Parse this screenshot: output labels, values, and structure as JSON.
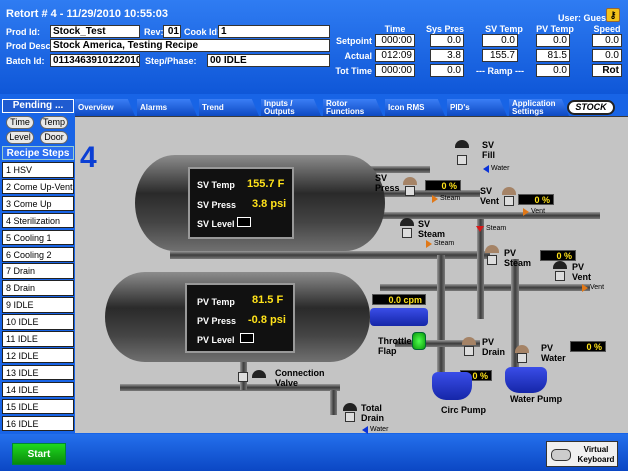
{
  "header": {
    "title": "Retort # 4 - 11/29/2010 10:55:03",
    "prod_id_label": "Prod Id:",
    "prod_id": "Stock_Test",
    "rev_label": "Rev:",
    "rev": "01",
    "cook_id_label": "Cook Id:",
    "cook_id": "1",
    "prod_desc_label": "Prod Desc:",
    "prod_desc": "Stock America, Testing Recipe",
    "batch_id_label": "Batch Id:",
    "batch_id": "0113463910122010",
    "step_phase_label": "Step/Phase:",
    "step_phase": "00 IDLE",
    "user_label": "User: Guest"
  },
  "readouts": {
    "columns": [
      "Time",
      "Sys Pres",
      "SV Temp",
      "PV Temp",
      "Speed"
    ],
    "rows": [
      {
        "label": "Setpoint",
        "values": [
          "000:00",
          "0.0",
          "0.0",
          "0.0",
          "0.0"
        ]
      },
      {
        "label": "Actual",
        "values": [
          "012:09",
          "3.8",
          "155.7",
          "81.5",
          "0.0"
        ]
      },
      {
        "label": "Tot Time",
        "values": [
          "000:00",
          "0.0",
          "",
          "0.0",
          "Rot"
        ]
      }
    ],
    "ramp_label": "--- Ramp ---"
  },
  "pending": {
    "title": "Pending ...",
    "buttons": [
      "Time",
      "Temp",
      "Level",
      "Door"
    ]
  },
  "recipe": {
    "title": "Recipe Steps",
    "steps": [
      "1 HSV",
      "2 Come Up-Vent",
      "3 Come Up",
      "4 Sterilization",
      "5 Cooling 1",
      "6 Cooling 2",
      "7 Drain",
      "8 Drain",
      "9 IDLE",
      "10 IDLE",
      "11 IDLE",
      "12 IDLE",
      "13 IDLE",
      "14 IDLE",
      "15 IDLE",
      "16 IDLE"
    ]
  },
  "tabs": [
    "Overview",
    "Alarms",
    "Trend",
    "Inputs / Outputs",
    "Rotor Functions",
    "Icon RMS",
    "PID's",
    "Application Settings"
  ],
  "stock_tab": "STOCK",
  "process": {
    "retort_number": "4",
    "sv": {
      "temp_label": "SV Temp",
      "temp": "155.7 F",
      "press_label": "SV Press",
      "press": "3.8 psi",
      "level_label": "SV Level"
    },
    "pv": {
      "temp_label": "PV Temp",
      "temp": "81.5 F",
      "press_label": "PV Press",
      "press": "-0.8 psi",
      "level_label": "PV Level"
    },
    "labels": {
      "sv_fill": "SV Fill",
      "water": "Water",
      "sv_press": "SV Press",
      "steam": "Steam",
      "sv_vent": "SV Vent",
      "vent": "Vent",
      "sv_steam": "SV Steam",
      "pv_steam": "PV Steam",
      "pv_vent": "PV Vent",
      "throttle_flap": "Throttle Flap",
      "pv_drain": "PV Drain",
      "pv_water": "PV Water",
      "connection_valve": "Connection Valve",
      "total_drain": "Total Drain",
      "circ_pump": "Circ Pump",
      "water_pump": "Water Pump"
    },
    "indicators": {
      "sv_press": "0 %",
      "sv_vent": "0 %",
      "pv_steam": "0 %",
      "pv_vent": "0 %",
      "pv_water": "0 %",
      "circ": "0 %",
      "speed": "0.0 cpm"
    }
  },
  "footer": {
    "start": "Start",
    "virtual_keyboard": "Virtual Keyboard"
  },
  "colors": {
    "header_blue": "#1864e6",
    "display_yellow": "#ffe21a",
    "start_green": "#1fd81f",
    "steam_arrow": "#e07818",
    "water_arrow": "#0a32d8"
  }
}
